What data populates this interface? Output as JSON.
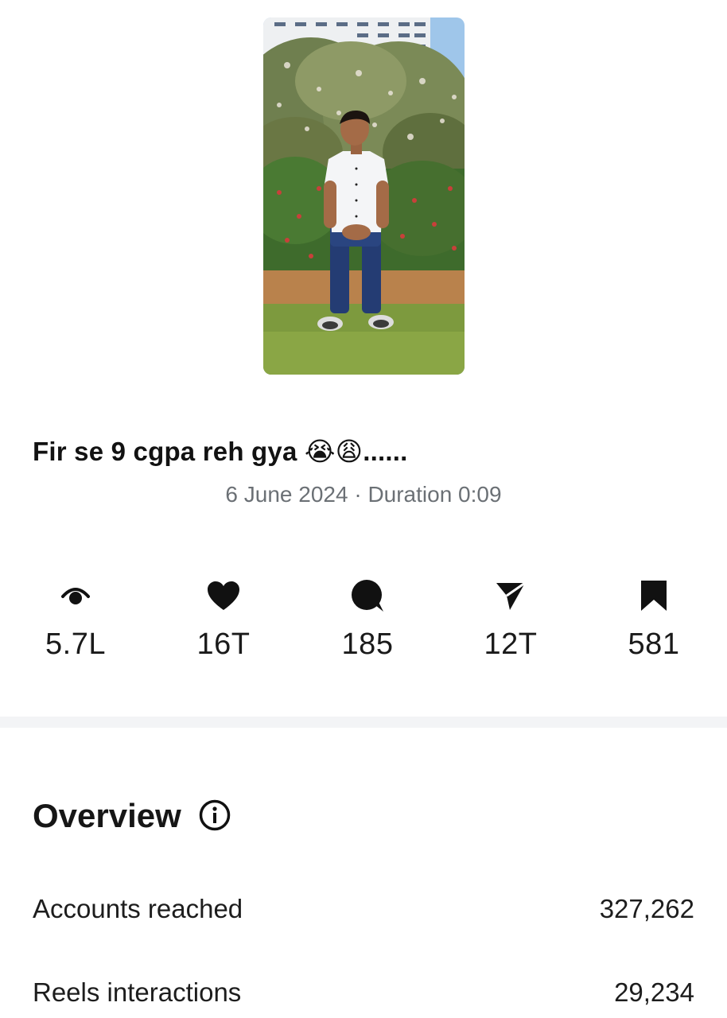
{
  "post": {
    "caption": "Fir se 9 cgpa reh gya 😭😩......",
    "meta": "6 June 2024 · Duration 0:09"
  },
  "stats": [
    {
      "icon": "eye-icon",
      "value": "5.7L"
    },
    {
      "icon": "heart-icon",
      "value": "16T"
    },
    {
      "icon": "comment-icon",
      "value": "185"
    },
    {
      "icon": "share-icon",
      "value": "12T"
    },
    {
      "icon": "bookmark-icon",
      "value": "581"
    }
  ],
  "overview": {
    "title": "Overview",
    "rows": [
      {
        "label": "Accounts reached",
        "value": "327,262"
      },
      {
        "label": "Reels interactions",
        "value": "29,234"
      }
    ]
  }
}
